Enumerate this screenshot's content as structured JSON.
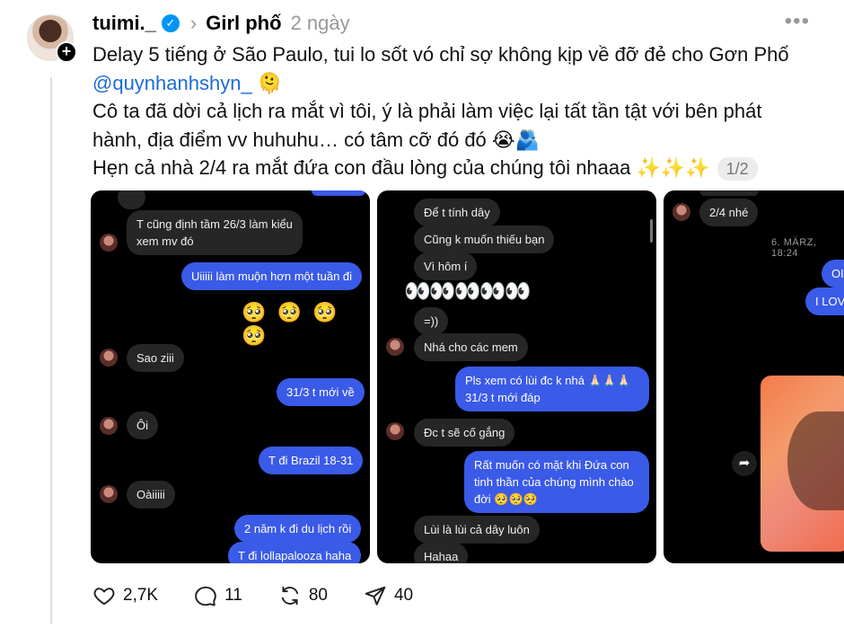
{
  "post": {
    "username": "tuimi._",
    "community": "Girl phố",
    "timestamp": "2 ngày",
    "line1": "Delay 5 tiếng ở São Paulo, tui lo sốt vó chỉ sợ không kịp về đỡ đẻ cho Gơn Phố",
    "mention": "@quynhanhshyn_",
    "mention_emoji": "🫠",
    "line3": "Cô ta đã dời cả lịch ra mắt vì tôi, ý là phải làm việc lại tất tần tật với bên phát",
    "line4": "hành, địa điểm vv huhuhu… có tâm cỡ đó đó 😭🫂",
    "line5": "Hẹn cả nhà 2/4 ra mắt đứa con đầu lòng của chúng tôi nhaaa ✨✨✨",
    "page_indicator": "1/2"
  },
  "media1": {
    "messages": [
      {
        "text": "T cũng định tầm 26/3 làm kiểu\nxem mv đó"
      },
      {
        "text": "Uiiiii làm muộn hơn một tuần đi"
      },
      {
        "text": "🥺 🥺 🥺 🥺"
      },
      {
        "text": "Sao ziii"
      },
      {
        "text": "31/3 t mới về"
      },
      {
        "text": "Ôi"
      },
      {
        "text": "T đi Brazil 18-31"
      },
      {
        "text": "Oàiiiii"
      },
      {
        "text": "2 năm k đi du lịch rồi"
      },
      {
        "text": "T đi lollapalooza haha"
      }
    ]
  },
  "media2": {
    "messages": [
      {
        "text": "Để t tính dây"
      },
      {
        "text": "Cũng k muốn thiếu bạn"
      },
      {
        "text": "Vì hôm í"
      },
      {
        "text": "👀👀👀👀👀"
      },
      {
        "text": "=))"
      },
      {
        "text": "Nhá cho các mem"
      },
      {
        "text": "Pls xem có lùi đc k nhá 🙏🏻🙏🏻🙏🏻\n31/3 t mới đáp"
      },
      {
        "text": "Đc t sẽ cố gắng"
      },
      {
        "text": "Rất muốn có mặt khi Đứa con tinh thần của chúng mình chào đời 🥺🥺🥺"
      },
      {
        "text": "Lùi là lùi cả dây luôn"
      },
      {
        "text": "Hahaa"
      }
    ]
  },
  "media3": {
    "messages": [
      {
        "text": "2/4 nhé"
      },
      {
        "text": "6. MÄRZ, 18:24"
      },
      {
        "text": "OI"
      },
      {
        "text": "I LOVE"
      }
    ]
  },
  "actions": {
    "likes": "2,7K",
    "comments": "11",
    "reposts": "80",
    "shares": "40"
  },
  "colors": {
    "verified": "#0095f6",
    "mention": "#1d6bd8",
    "outgoing_bubble": "#3a5ae8",
    "incoming_bubble": "#262626"
  }
}
